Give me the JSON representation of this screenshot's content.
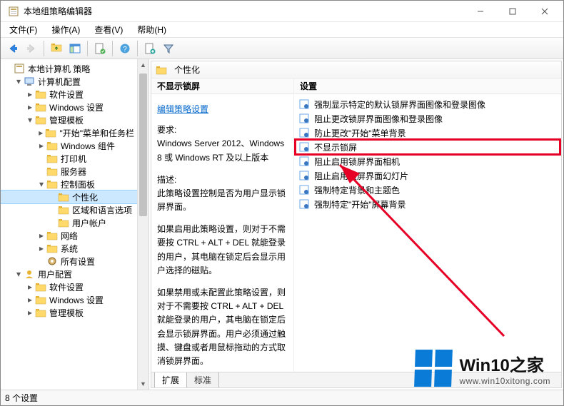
{
  "window": {
    "title": "本地组策略编辑器"
  },
  "menu": {
    "file": "文件(F)",
    "action": "操作(A)",
    "view": "查看(V)",
    "help": "帮助(H)"
  },
  "tree": {
    "root": "本地计算机 策略",
    "computer_config": "计算机配置",
    "software_settings": "软件设置",
    "windows_settings": "Windows 设置",
    "admin_templates": "管理模板",
    "start_taskbar": "\"开始\"菜单和任务栏",
    "windows_components": "Windows 组件",
    "printers": "打印机",
    "server": "服务器",
    "control_panel": "控制面板",
    "personalization": "个性化",
    "regional_lang": "区域和语言选项",
    "user_accounts": "用户帐户",
    "network": "网络",
    "system": "系统",
    "all_settings": "所有设置",
    "user_config": "用户配置",
    "u_software_settings": "软件设置",
    "u_windows_settings": "Windows 设置",
    "u_admin_templates": "管理模板"
  },
  "right": {
    "path": "个性化",
    "col_desc_head": "不显示锁屏",
    "edit_link": "编辑策略设置",
    "req_label": "要求:",
    "req_text": "Windows Server 2012、Windows 8 或 Windows RT 及以上版本",
    "desc_label": "描述:",
    "desc_p1": "此策略设置控制是否为用户显示锁屏界面。",
    "desc_p2": "如果启用此策略设置，则对于不需要按 CTRL + ALT + DEL  就能登录的用户，其电脑在锁定后会显示用户选择的磁贴。",
    "desc_p3": "如果禁用或未配置此策略设置，则对于不需要按 CTRL + ALT + DEL 就能登录的用户，其电脑在锁定后会显示锁屏界面。用户必须通过触摸、键盘或者用鼠标拖动的方式取消锁屏界面。",
    "col_list_head": "设置",
    "items": [
      "强制显示特定的默认锁屏界面图像和登录图像",
      "阻止更改锁屏界面图像和登录图像",
      "防止更改\"开始\"菜单背景",
      "不显示锁屏",
      "阻止启用锁屏界面相机",
      "阻止启用锁屏界面幻灯片",
      "强制特定背景和主题色",
      "强制特定\"开始\"屏幕背景"
    ],
    "tabs": {
      "extended": "扩展",
      "standard": "标准"
    }
  },
  "status": {
    "text": "8 个设置"
  },
  "watermark": {
    "brand": "Win10",
    "zh": "之家",
    "url": "www.win10xitong.com"
  }
}
